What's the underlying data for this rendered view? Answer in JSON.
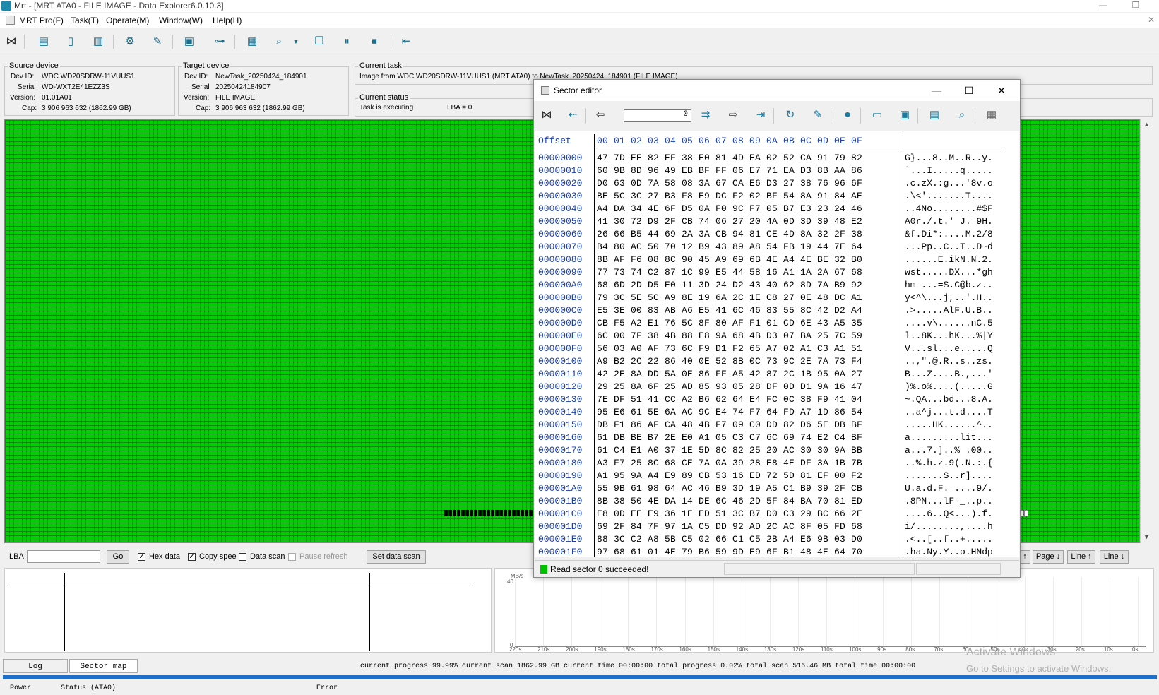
{
  "window": {
    "title": "Mrt - [MRT ATA0 - FILE IMAGE - Data Explorer6.0.10.3]",
    "minimize": "—",
    "restore": "❐",
    "close": "✕"
  },
  "menu": {
    "items": [
      "MRT Pro(F)",
      "Task(T)",
      "Operate(M)",
      "Window(W)",
      "Help(H)"
    ],
    "close": "✕"
  },
  "source_device": {
    "group_label": "Source device",
    "dev_id_label": "Dev ID:",
    "dev_id": "WDC WD20SDRW-11VUUS1",
    "serial_label": "Serial",
    "serial": "WD-WXT2E41EZZ3S",
    "version_label": "Version:",
    "version": "01.01A01",
    "cap_label": "Cap:",
    "cap": "3 906 963 632 (1862.99 GB)"
  },
  "target_device": {
    "group_label": "Target device",
    "dev_id_label": "Dev ID:",
    "dev_id": "NewTask_20250424_184901",
    "serial_label": "Serial",
    "serial": "20250424184907",
    "version_label": "Version:",
    "version": "FILE IMAGE",
    "cap_label": "Cap:",
    "cap": "3 906 963 632 (1862.99 GB)"
  },
  "current_task": {
    "group_label": "Current task",
    "text": "Image from WDC WD20SDRW-11VUUS1 (MRT ATA0) to NewTask_20250424_184901 (FILE IMAGE)"
  },
  "current_status": {
    "group_label": "Current status",
    "text": "Task is executing",
    "lba": "LBA = 0"
  },
  "controls": {
    "lba_label": "LBA",
    "lba_value": "",
    "go": "Go",
    "hex_data": "Hex data",
    "copy_speed": "Copy spee",
    "data_scan": "Data scan",
    "pause_refresh": "Pause refresh",
    "set_data_scan": "Set data scan",
    "page_up": "↑",
    "page_down": "Page ↓",
    "line_up": "Line ↑",
    "line_down": "Line ↓"
  },
  "speed_chart": {
    "unit": "MB/s",
    "y_top": "40",
    "y_zero": "0",
    "x_ticks": [
      "220s",
      "210s",
      "200s",
      "190s",
      "180s",
      "170s",
      "160s",
      "150s",
      "140s",
      "130s",
      "120s",
      "110s",
      "100s",
      "90s",
      "80s",
      "70s",
      "60s",
      "50s",
      "40s",
      "30s",
      "20s",
      "10s",
      "0s"
    ]
  },
  "tabs": {
    "log": "Log",
    "sector_map": "Sector map"
  },
  "status_line": "current progress 99.99% current scan  1862.99 GB  current time  00:00:00  total progress 0.02% total scan 516.46 MB total time 00:00:00",
  "bottom": {
    "power": "Power",
    "status": "Status (ATA0)",
    "error": "Error"
  },
  "watermark": {
    "line1": "Activate Windows",
    "line2": "Go to Settings to activate Windows."
  },
  "sector_editor": {
    "title": "Sector editor",
    "sector_value": "0",
    "offset_header": "Offset",
    "col_header": "00 01 02 03 04 05 06 07 08 09 0A 0B 0C 0D 0E 0F",
    "status": "Read sector 0 succeeded!",
    "rows": [
      {
        "off": "00000000",
        "hex": "47 7D EE 82 EF 38 E0 81 4D EA 02 52 CA 91 79 82",
        "asc": "G}...8..M..R..y."
      },
      {
        "off": "00000010",
        "hex": "60 9B 8D 96 49 EB BF FF 06 E7 71 EA D3 8B AA 86",
        "asc": "`...I.....q....."
      },
      {
        "off": "00000020",
        "hex": "D0 63 0D 7A 58 08 3A 67 CA E6 D3 27 38 76 96 6F",
        "asc": ".c.zX.:g...'8v.o"
      },
      {
        "off": "00000030",
        "hex": "BE 5C 3C 27 B3 F8 E9 DC F2 02 BF 54 8A 91 84 AE",
        "asc": ".\\<'.......T...."
      },
      {
        "off": "00000040",
        "hex": "A4 DA 34 4E 6F D5 0A F0 9C F7 05 B7 E3 23 24 46",
        "asc": "..4No........#$F"
      },
      {
        "off": "00000050",
        "hex": "41 30 72 D9 2F CB 74 06 27 20 4A 0D 3D 39 48 E2",
        "asc": "A0r./.t.' J.=9H."
      },
      {
        "off": "00000060",
        "hex": "26 66 B5 44 69 2A 3A CB 94 81 CE 4D 8A 32 2F 38",
        "asc": "&f.Di*:....M.2/8"
      },
      {
        "off": "00000070",
        "hex": "B4 80 AC 50 70 12 B9 43 89 A8 54 FB 19 44 7E 64",
        "asc": "...Pp..C..T..D~d"
      },
      {
        "off": "00000080",
        "hex": "8B AF F6 08 8C 90 45 A9 69 6B 4E A4 4E BE 32 B0",
        "asc": "......E.ikN.N.2."
      },
      {
        "off": "00000090",
        "hex": "77 73 74 C2 87 1C 99 E5 44 58 16 A1 1A 2A 67 68",
        "asc": "wst.....DX...*gh"
      },
      {
        "off": "000000A0",
        "hex": "68 6D 2D D5 E0 11 3D 24 D2 43 40 62 8D 7A B9 92",
        "asc": "hm-...=$.C@b.z.."
      },
      {
        "off": "000000B0",
        "hex": "79 3C 5E 5C A9 8E 19 6A 2C 1E C8 27 0E 48 DC A1",
        "asc": "y<^\\...j,..'.H.."
      },
      {
        "off": "000000C0",
        "hex": "E5 3E 00 83 AB A6 E5 41 6C 46 83 55 8C 42 D2 A4",
        "asc": ".>.....AlF.U.B.."
      },
      {
        "off": "000000D0",
        "hex": "CB F5 A2 E1 76 5C 8F 80 AF F1 01 CD 6E 43 A5 35",
        "asc": "....v\\......nC.5"
      },
      {
        "off": "000000E0",
        "hex": "6C 00 7F 38 4B 88 E8 9A 68 4B D3 07 BA 25 7C 59",
        "asc": "l..8K...hK...%|Y"
      },
      {
        "off": "000000F0",
        "hex": "56 03 A0 AF 73 6C F9 D1 F2 65 A7 02 A1 C3 A1 51",
        "asc": "V...sl...e.....Q"
      },
      {
        "off": "00000100",
        "hex": "A9 B2 2C 22 86 40 0E 52 8B 0C 73 9C 2E 7A 73 F4",
        "asc": "..,\".@.R..s..zs."
      },
      {
        "off": "00000110",
        "hex": "42 2E 8A DD 5A 0E 86 FF A5 42 87 2C 1B 95 0A 27",
        "asc": "B...Z....B.,...'"
      },
      {
        "off": "00000120",
        "hex": "29 25 8A 6F 25 AD 85 93 05 28 DF 0D D1 9A 16 47",
        "asc": ")%.o%....(.....G"
      },
      {
        "off": "00000130",
        "hex": "7E DF 51 41 CC A2 B6 62 64 E4 FC 0C 38 F9 41 04",
        "asc": "~.QA...bd...8.A."
      },
      {
        "off": "00000140",
        "hex": "95 E6 61 5E 6A AC 9C E4 74 F7 64 FD A7 1D 86 54",
        "asc": "..a^j...t.d....T"
      },
      {
        "off": "00000150",
        "hex": "DB F1 86 AF CA 48 4B F7 09 C0 DD 82 D6 5E DB BF",
        "asc": ".....HK......^.."
      },
      {
        "off": "00000160",
        "hex": "61 DB BE B7 2E E0 A1 05 C3 C7 6C 69 74 E2 C4 BF",
        "asc": "a.........lit..."
      },
      {
        "off": "00000170",
        "hex": "61 C4 E1 A0 37 1E 5D 8C 82 25 20 AC 30 30 9A BB",
        "asc": "a...7.]..% .00.."
      },
      {
        "off": "00000180",
        "hex": "A3 F7 25 8C 68 CE 7A 0A 39 28 E8 4E DF 3A 1B 7B",
        "asc": "..%.h.z.9(.N.:.{"
      },
      {
        "off": "00000190",
        "hex": "A1 95 9A A4 E9 89 CB 53 16 ED 72 5D 81 EF 00 F2",
        "asc": ".......S..r]...."
      },
      {
        "off": "000001A0",
        "hex": "55 9B 61 98 64 AC 46 B9 3D 19 A5 C1 B9 39 2F CB",
        "asc": "U.a.d.F.=....9/."
      },
      {
        "off": "000001B0",
        "hex": "8B 38 50 4E DA 14 DE 6C 46 2D 5F 84 BA 70 81 ED",
        "asc": ".8PN...lF-_..p.."
      },
      {
        "off": "000001C0",
        "hex": "E8 0D EE E9 36 1E ED 51 3C B7 D0 C3 29 BC 66 2E",
        "asc": "....6..Q<...).f."
      },
      {
        "off": "000001D0",
        "hex": "69 2F 84 7F 97 1A C5 DD 92 AD 2C AC 8F 05 FD 68",
        "asc": "i/........,....h"
      },
      {
        "off": "000001E0",
        "hex": "88 3C C2 A8 5B C5 02 66 C1 C5 2B A4 E6 9B 03 D0",
        "asc": ".<..[..f..+....."
      },
      {
        "off": "000001F0",
        "hex": "97 68 61 01 4E 79 B6 59 9D E9 6F B1 48 4E 64 70",
        "asc": ".ha.Ny.Y..o.HNdp"
      }
    ]
  }
}
